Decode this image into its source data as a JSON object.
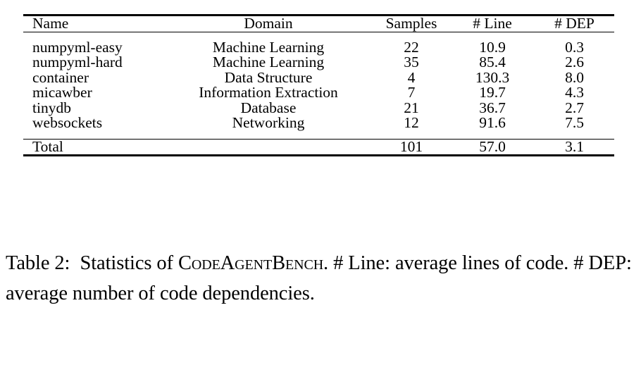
{
  "table": {
    "columns": [
      {
        "key": "name",
        "label": "Name"
      },
      {
        "key": "domain",
        "label": "Domain"
      },
      {
        "key": "samples",
        "label": "Samples"
      },
      {
        "key": "line",
        "label": "# Line"
      },
      {
        "key": "dep",
        "label": "# DEP"
      }
    ],
    "rows": [
      {
        "name": "numpyml-easy",
        "domain": "Machine Learning",
        "samples": "22",
        "line": "10.9",
        "dep": "0.3"
      },
      {
        "name": "numpyml-hard",
        "domain": "Machine Learning",
        "samples": "35",
        "line": "85.4",
        "dep": "2.6"
      },
      {
        "name": "container",
        "domain": "Data Structure",
        "samples": "4",
        "line": "130.3",
        "dep": "8.0"
      },
      {
        "name": "micawber",
        "domain": "Information Extraction",
        "samples": "7",
        "line": "19.7",
        "dep": "4.3"
      },
      {
        "name": "tinydb",
        "domain": "Database",
        "samples": "21",
        "line": "36.7",
        "dep": "2.7"
      },
      {
        "name": "websockets",
        "domain": "Networking",
        "samples": "12",
        "line": "91.6",
        "dep": "7.5"
      }
    ],
    "total": {
      "name": "Total",
      "domain": "",
      "samples": "101",
      "line": "57.0",
      "dep": "3.1"
    }
  },
  "caption": {
    "label": "Table 2:",
    "lead": "Statistics of ",
    "benchmark_name": "CodeAgentBench",
    "rest": ". # Line: average lines of code. # DEP: average number of code dependencies."
  }
}
